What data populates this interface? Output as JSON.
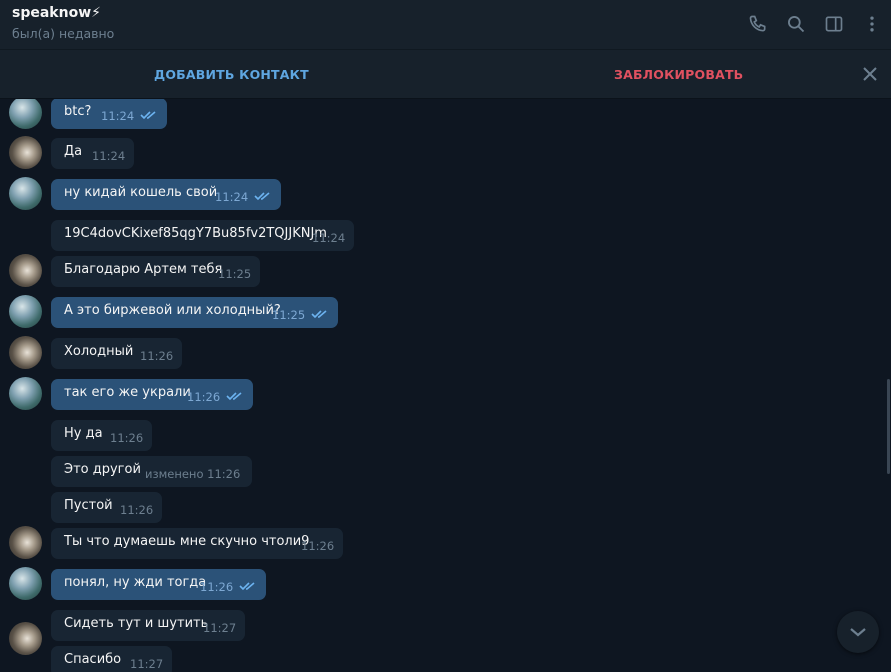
{
  "header": {
    "title": "speaknow⚡",
    "status": "был(а) недавно",
    "icons": [
      "phone-icon",
      "search-icon",
      "sidebar-icon",
      "more-icon"
    ]
  },
  "action_bar": {
    "add_contact": "ДОБАВИТЬ КОНТАКТ",
    "block": "ЗАБЛОКИРОВАТЬ"
  },
  "colors": {
    "bg": "#0e1621",
    "panel": "#17212b",
    "bubble_out": "#2b5278",
    "bubble_in": "#182533",
    "accent": "#5fa6e0",
    "danger": "#e05160"
  },
  "messages": [
    {
      "dir": "out",
      "text": "btc?",
      "time": "11:24",
      "read": true
    },
    {
      "dir": "in",
      "text": "Да",
      "time": "11:24"
    },
    {
      "dir": "out",
      "text": "ну кидай кошель свой",
      "time": "11:24",
      "read": true
    },
    {
      "dir": "in",
      "text": "19C4dovCKixef85qgY7Bu85fv2TQJJKNJm",
      "time": "11:24"
    },
    {
      "dir": "in",
      "text": "Благодарю Артем тебя",
      "time": "11:25"
    },
    {
      "dir": "out",
      "text": "А это биржевой или холодный?",
      "time": "11:25",
      "read": true
    },
    {
      "dir": "in",
      "text": "Холодный",
      "time": "11:26"
    },
    {
      "dir": "out",
      "text": "так его же украли",
      "time": "11:26",
      "read": true
    },
    {
      "dir": "in",
      "text": "Ну да",
      "time": "11:26"
    },
    {
      "dir": "in",
      "text": "Это другой",
      "time": "изменено 11:26"
    },
    {
      "dir": "in",
      "text": "Пустой",
      "time": "11:26"
    },
    {
      "dir": "in",
      "text": "Ты что думаешь мне скучно чтоли9",
      "time": "11:26"
    },
    {
      "dir": "out",
      "text": "понял, ну жди тогда",
      "time": "11:26",
      "read": true
    },
    {
      "dir": "in",
      "text": "Сидеть тут и шутить",
      "time": "11:27"
    },
    {
      "dir": "in",
      "text": "Спасибо",
      "time": "11:27"
    }
  ]
}
